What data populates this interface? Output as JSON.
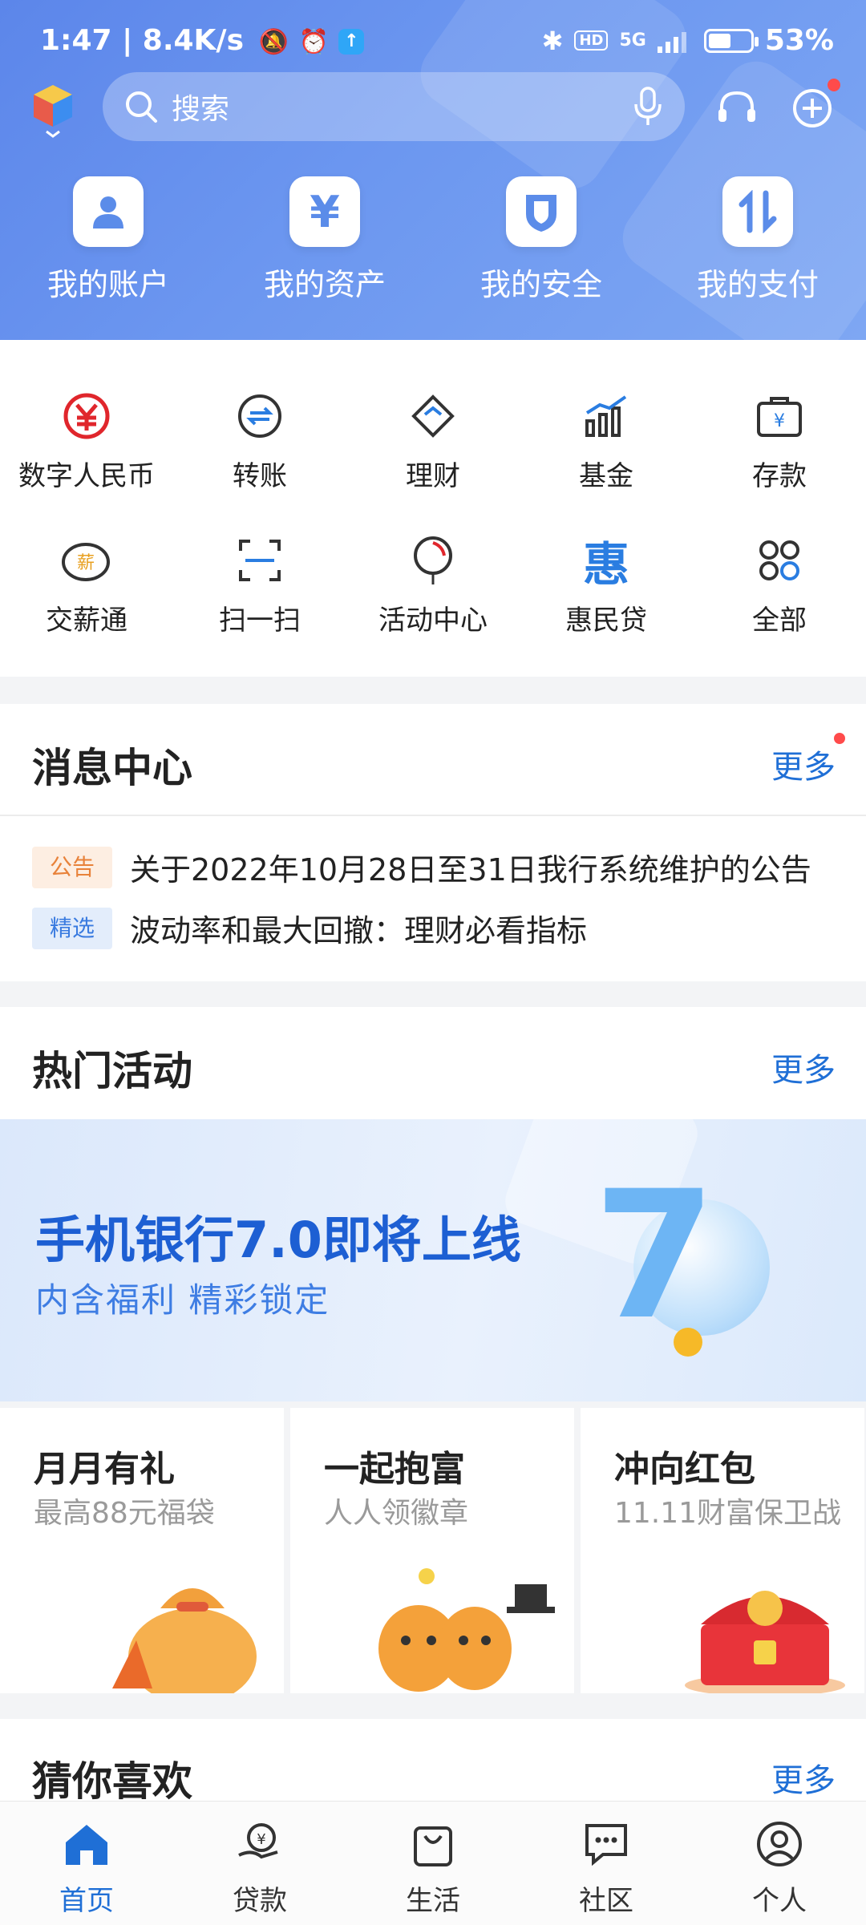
{
  "status_bar": {
    "time": "1:47",
    "speed": "8.4K/s",
    "network": "5G",
    "battery": "53%",
    "battery_level": 0.53
  },
  "search": {
    "placeholder": "搜索"
  },
  "quick_actions": [
    "我的账户",
    "我的资产",
    "我的安全",
    "我的支付"
  ],
  "grid": [
    {
      "label": "数字人民币",
      "icon": "digital-rmb-icon"
    },
    {
      "label": "转账",
      "icon": "transfer-icon"
    },
    {
      "label": "理财",
      "icon": "wealth-icon"
    },
    {
      "label": "基金",
      "icon": "fund-icon"
    },
    {
      "label": "存款",
      "icon": "deposit-icon"
    },
    {
      "label": "交薪通",
      "icon": "salary-icon"
    },
    {
      "label": "扫一扫",
      "icon": "scan-icon"
    },
    {
      "label": "活动中心",
      "icon": "balloon-icon"
    },
    {
      "label": "惠民贷",
      "icon": "loan-icon"
    },
    {
      "label": "全部",
      "icon": "all-apps-icon"
    }
  ],
  "salary_icon_char": "薪",
  "loan_icon_char": "惠",
  "messages": {
    "title": "消息中心",
    "more": "更多",
    "items": [
      {
        "tag": "公告",
        "text": "关于2022年10月28日至31日我行系统维护的公告"
      },
      {
        "tag": "精选",
        "text": "波动率和最大回撤：理财必看指标"
      }
    ]
  },
  "hot": {
    "title": "热门活动",
    "more": "更多",
    "banner_title": "手机银行7.0即将上线",
    "banner_sub": "内含福利  精彩锁定",
    "banner_logo": "7"
  },
  "promos": [
    {
      "title": "月月有礼",
      "subtitle": "最高88元福袋"
    },
    {
      "title": "一起抱富",
      "subtitle": "人人领徽章"
    },
    {
      "title": "冲向红包",
      "subtitle": "11.11财富保卫战"
    }
  ],
  "guess": {
    "title": "猜你喜欢",
    "more": "更多"
  },
  "bottom_nav": [
    "首页",
    "贷款",
    "生活",
    "社区",
    "个人"
  ],
  "colors": {
    "header": "#6a93ee",
    "accent": "#1f6fd6",
    "red": "#e0262c",
    "orange_tag": "#e8823a"
  }
}
